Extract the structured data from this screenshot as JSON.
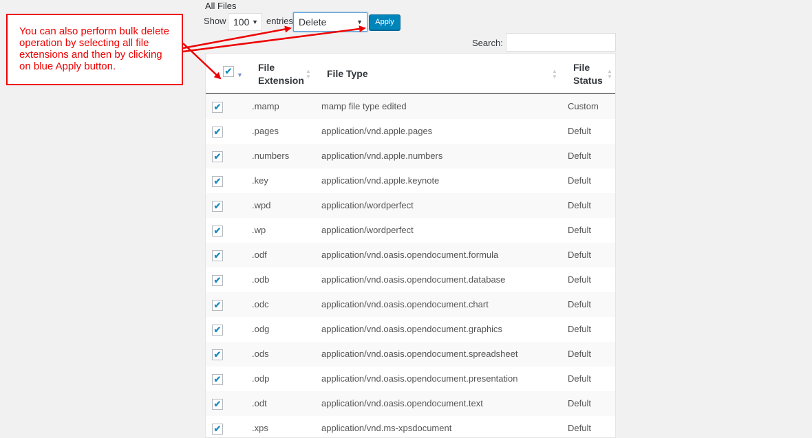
{
  "page": {
    "title": "All Files"
  },
  "toolbar": {
    "show_label": "Show",
    "entries_value": "100",
    "entries_label": "entries",
    "bulk_action": "Delete",
    "apply_label": "Apply",
    "search_label": "Search:",
    "search_value": ""
  },
  "table": {
    "headers": {
      "extension_line1": "File",
      "extension_line2": "Extension",
      "type": "File Type",
      "status_line1": "File",
      "status_line2": "Status"
    },
    "rows": [
      {
        "ext": ".mamp",
        "type": "mamp file type edited",
        "status": "Custom"
      },
      {
        "ext": ".pages",
        "type": "application/vnd.apple.pages",
        "status": "Defult"
      },
      {
        "ext": ".numbers",
        "type": "application/vnd.apple.numbers",
        "status": "Defult"
      },
      {
        "ext": ".key",
        "type": "application/vnd.apple.keynote",
        "status": "Defult"
      },
      {
        "ext": ".wpd",
        "type": "application/wordperfect",
        "status": "Defult"
      },
      {
        "ext": ".wp",
        "type": "application/wordperfect",
        "status": "Defult"
      },
      {
        "ext": ".odf",
        "type": "application/vnd.oasis.opendocument.formula",
        "status": "Defult"
      },
      {
        "ext": ".odb",
        "type": "application/vnd.oasis.opendocument.database",
        "status": "Defult"
      },
      {
        "ext": ".odc",
        "type": "application/vnd.oasis.opendocument.chart",
        "status": "Defult"
      },
      {
        "ext": ".odg",
        "type": "application/vnd.oasis.opendocument.graphics",
        "status": "Defult"
      },
      {
        "ext": ".ods",
        "type": "application/vnd.oasis.opendocument.spreadsheet",
        "status": "Defult"
      },
      {
        "ext": ".odp",
        "type": "application/vnd.oasis.opendocument.presentation",
        "status": "Defult"
      },
      {
        "ext": ".odt",
        "type": "application/vnd.oasis.opendocument.text",
        "status": "Defult"
      },
      {
        "ext": ".xps",
        "type": "application/vnd.ms-xpsdocument",
        "status": "Defult"
      }
    ]
  },
  "annotation": {
    "text": "You can also perform bulk delete operation by selecting all file extensions and then by clicking on blue Apply button.",
    "color": "#ee0000"
  }
}
